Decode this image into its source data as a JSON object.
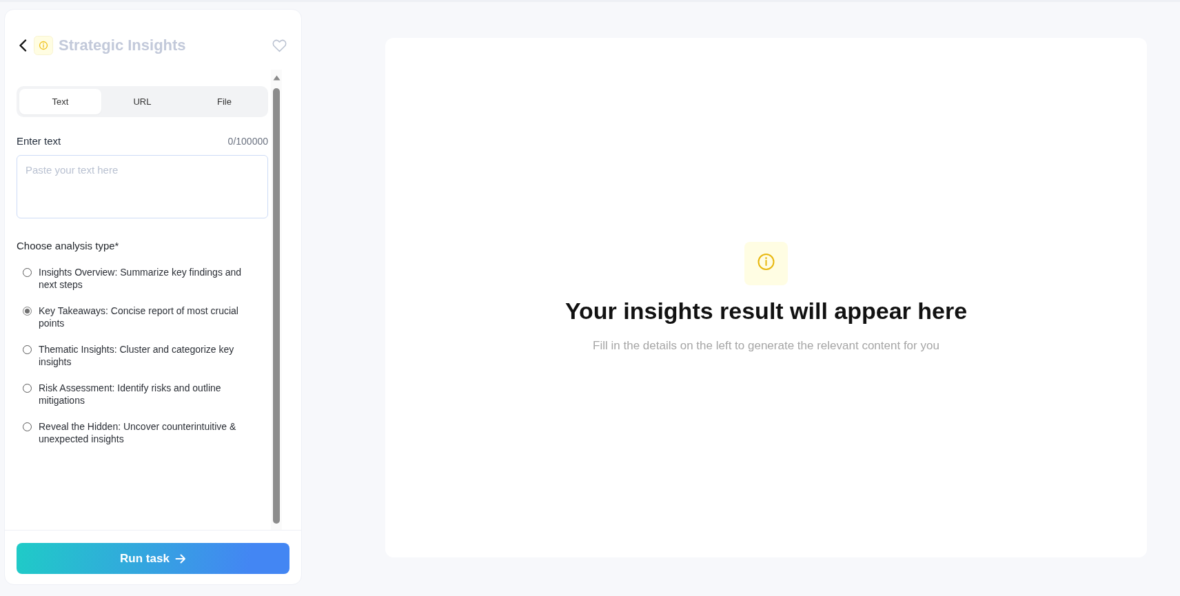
{
  "header": {
    "title": "Strategic Insights",
    "favorite": false
  },
  "tabs": [
    {
      "label": "Text",
      "selected": true
    },
    {
      "label": "URL",
      "selected": false
    },
    {
      "label": "File",
      "selected": false
    }
  ],
  "text_input": {
    "label": "Enter text",
    "counter": "0/100000",
    "placeholder": "Paste your text here"
  },
  "analysis": {
    "label": "Choose analysis type*",
    "options": [
      {
        "label": "Insights Overview: Summarize key findings and next steps",
        "selected": false
      },
      {
        "label": "Key Takeaways: Concise report of most crucial points",
        "selected": true
      },
      {
        "label": "Thematic Insights: Cluster and categorize key insights",
        "selected": false
      },
      {
        "label": "Risk Assessment: Identify risks and outline mitigations",
        "selected": false
      },
      {
        "label": "Reveal the Hidden: Uncover counterintuitive & unexpected insights",
        "selected": false
      }
    ]
  },
  "run_button": {
    "label": "Run task"
  },
  "result": {
    "heading": "Your insights result will appear here",
    "subtitle": "Fill in the details on the left to generate the relevant content for you"
  }
}
